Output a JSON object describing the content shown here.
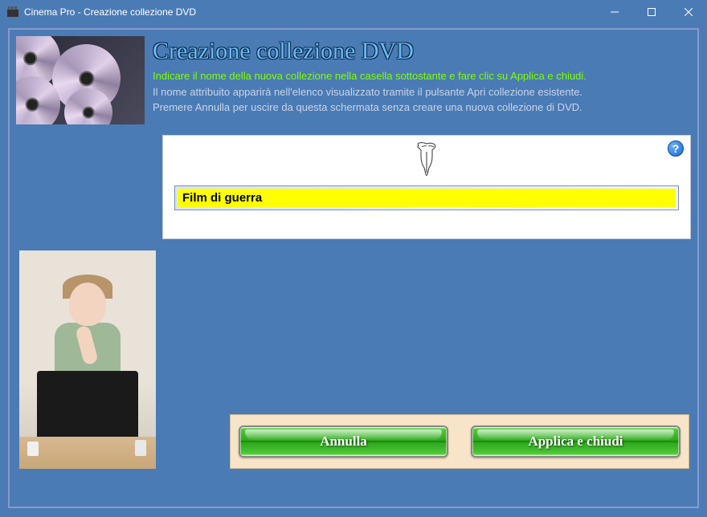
{
  "titlebar": {
    "title": "Cinema Pro - Creazione collezione DVD"
  },
  "header": {
    "title": "Creazione collezione DVD",
    "instruction_highlight": "Indicare il nome della nuova collezione nella casella sottostante e fare clic su Applica e chiudi.",
    "instruction_line2": "Il nome attribuito apparirà nell'elenco visualizzato tramite il pulsante Apri collezione esistente.",
    "instruction_line3": "Premere Annulla per uscire da questa schermata senza creare una nuova collezione di DVD."
  },
  "form": {
    "collection_name": "Film di guerra"
  },
  "buttons": {
    "cancel": "Annulla",
    "apply": "Applica e chiudi"
  }
}
